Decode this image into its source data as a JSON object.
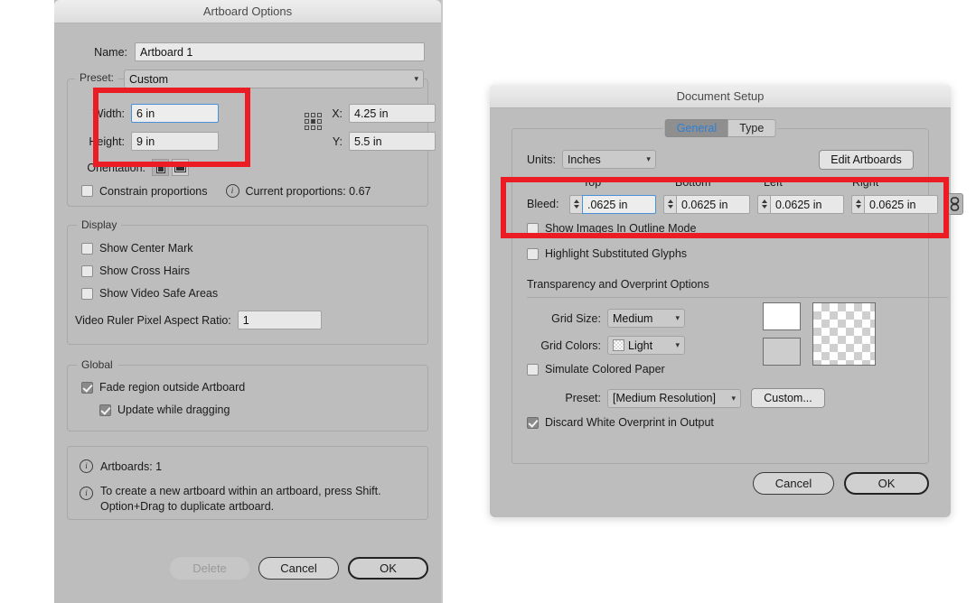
{
  "meta": {
    "accent_blue": "#4a90d9",
    "highlight_red": "#ec1c24",
    "dialog_bg": "#bdbdbd",
    "titlebar_text": "#4a4a4a"
  },
  "artboard_dialog": {
    "title": "Artboard Options",
    "name_label": "Name:",
    "name_value": "Artboard 1",
    "preset_label": "Preset:",
    "preset_value": "Custom",
    "width_label": "Width:",
    "width_value": "6 in",
    "height_label": "Height:",
    "height_value": "9 in",
    "x_label": "X:",
    "x_value": "4.25 in",
    "y_label": "Y:",
    "y_value": "5.5 in",
    "orientation_label": "Orientation:",
    "constrain_label": "Constrain proportions",
    "constrain_checked": false,
    "current_proportions": "Current proportions: 0.67",
    "display_group": "Display",
    "show_center_mark": "Show Center Mark",
    "show_cross_hairs": "Show Cross Hairs",
    "show_video_safe": "Show Video Safe Areas",
    "video_ruler_label": "Video Ruler Pixel Aspect Ratio:",
    "video_ruler_value": "1",
    "global_group": "Global",
    "fade_region": "Fade region outside Artboard",
    "update_while_dragging": "Update while dragging",
    "artboards_count": "Artboards: 1",
    "hint_line1": "To create a new artboard within an artboard, press Shift.",
    "hint_line2": "Option+Drag to duplicate artboard.",
    "delete_label": "Delete",
    "cancel_label": "Cancel",
    "ok_label": "OK"
  },
  "document_setup_dialog": {
    "title": "Document Setup",
    "tabs": [
      {
        "label": "General",
        "active": true
      },
      {
        "label": "Type",
        "active": false
      }
    ],
    "units_label": "Units:",
    "units_value": "Inches",
    "edit_artboards_label": "Edit Artboards",
    "bleed_label": "Bleed:",
    "bleed_columns": [
      "Top",
      "Bottom",
      "Left",
      "Right"
    ],
    "bleed_values": [
      ".0625 in",
      "0.0625 in",
      "0.0625 in",
      "0.0625 in"
    ],
    "show_images_outline": "Show Images In Outline Mode",
    "highlight_glyphs": "Highlight Substituted Glyphs",
    "transparency_header": "Transparency and Overprint Options",
    "grid_size_label": "Grid Size:",
    "grid_size_value": "Medium",
    "grid_colors_label": "Grid Colors:",
    "grid_colors_value": "Light",
    "simulate_colored_paper": "Simulate Colored Paper",
    "preset_label": "Preset:",
    "preset_value": "[Medium Resolution]",
    "custom_label": "Custom...",
    "discard_white_overprint": "Discard White Overprint in Output",
    "cancel_label": "Cancel",
    "ok_label": "OK"
  }
}
